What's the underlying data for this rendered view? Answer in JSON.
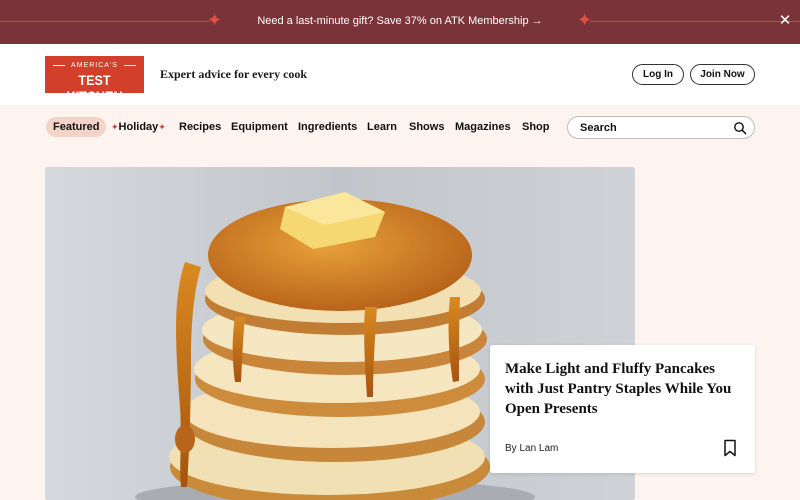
{
  "promo": {
    "text": "Need a last-minute gift? Save 37% on ATK Membership →",
    "close_glyph": "✕",
    "left_ornament": "star-ornament-icon",
    "right_ornament": "star-ornament-icon"
  },
  "header": {
    "logo_top": "AMERICA'S",
    "logo_bottom": "TEST KITCHEN",
    "tagline": "Expert advice for every cook",
    "login_label": "Log In",
    "join_label": "Join Now"
  },
  "nav": {
    "items": [
      {
        "label": "Featured",
        "active": true
      },
      {
        "label": "Holiday",
        "accent": true
      },
      {
        "label": "Recipes"
      },
      {
        "label": "Equipment"
      },
      {
        "label": "Ingredients"
      },
      {
        "label": "Learn"
      },
      {
        "label": "Shows"
      },
      {
        "label": "Magazines"
      },
      {
        "label": "Shop"
      }
    ],
    "search_placeholder": "Search"
  },
  "hero": {
    "image": "pancake-stack-with-butter-and-syrup",
    "title": "Make Light and Fluffy Pancakes with Just Pantry Staples While You Open Presents",
    "author": "By Lan Lam",
    "bookmark_icon": "bookmark-icon"
  },
  "colors": {
    "promo_bg": "#7a3338",
    "brand_red": "#d2402c",
    "nav_bg": "#fdf3ef",
    "active_pill": "#f4d4c8"
  }
}
